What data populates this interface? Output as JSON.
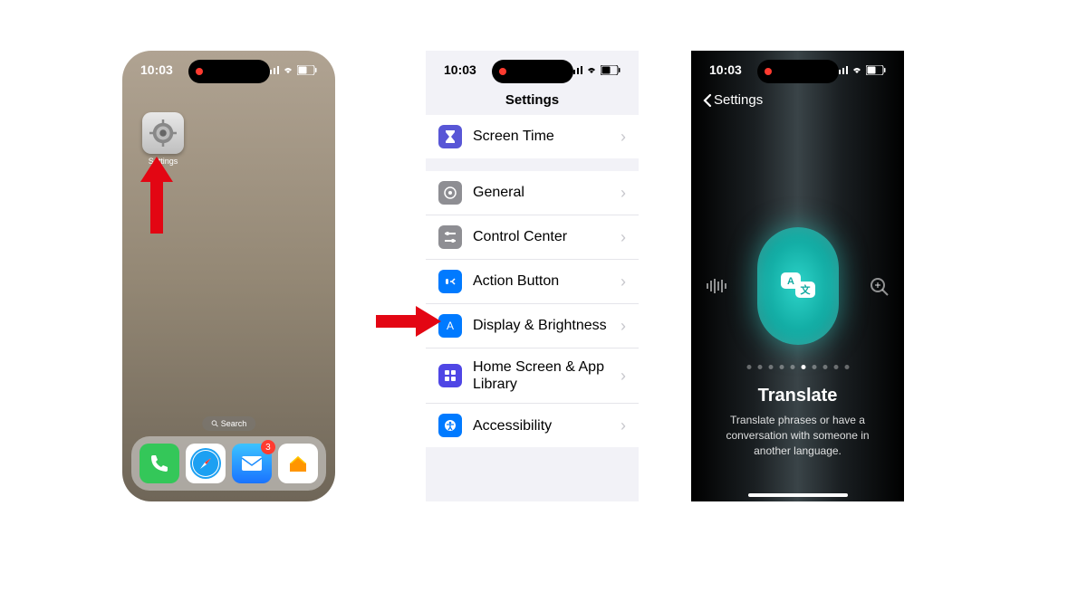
{
  "status": {
    "time": "10:03",
    "signal_icon": "signal-bars",
    "wifi_icon": "wifi",
    "battery_level": "50"
  },
  "phone1": {
    "app_icon_label": "Settings",
    "search_label": "Search",
    "dock": [
      {
        "name": "Phone",
        "bg": "#34c759"
      },
      {
        "name": "Safari",
        "bg": "#fff"
      },
      {
        "name": "Mail",
        "bg": "#1a8cff",
        "badge": "3"
      },
      {
        "name": "Home",
        "bg": "#fff"
      }
    ]
  },
  "phone2": {
    "title": "Settings",
    "group1": [
      {
        "label": "Screen Time",
        "icon_bg": "#5856d6",
        "icon": "hourglass"
      }
    ],
    "group2": [
      {
        "label": "General",
        "icon_bg": "#8e8e93",
        "icon": "gear"
      },
      {
        "label": "Control Center",
        "icon_bg": "#8e8e93",
        "icon": "sliders"
      },
      {
        "label": "Action Button",
        "icon_bg": "#007aff",
        "icon": "action"
      },
      {
        "label": "Display & Brightness",
        "icon_bg": "#007aff",
        "icon": "sun"
      },
      {
        "label": "Home Screen & App Library",
        "icon_bg": "#4f46e5",
        "icon": "grid"
      },
      {
        "label": "Accessibility",
        "icon_bg": "#007aff",
        "icon": "person"
      }
    ]
  },
  "phone3": {
    "back_label": "Settings",
    "feature_title": "Translate",
    "feature_desc": "Translate phrases or have a conversation with someone in another language.",
    "page_count": 10,
    "page_active_index": 5
  }
}
